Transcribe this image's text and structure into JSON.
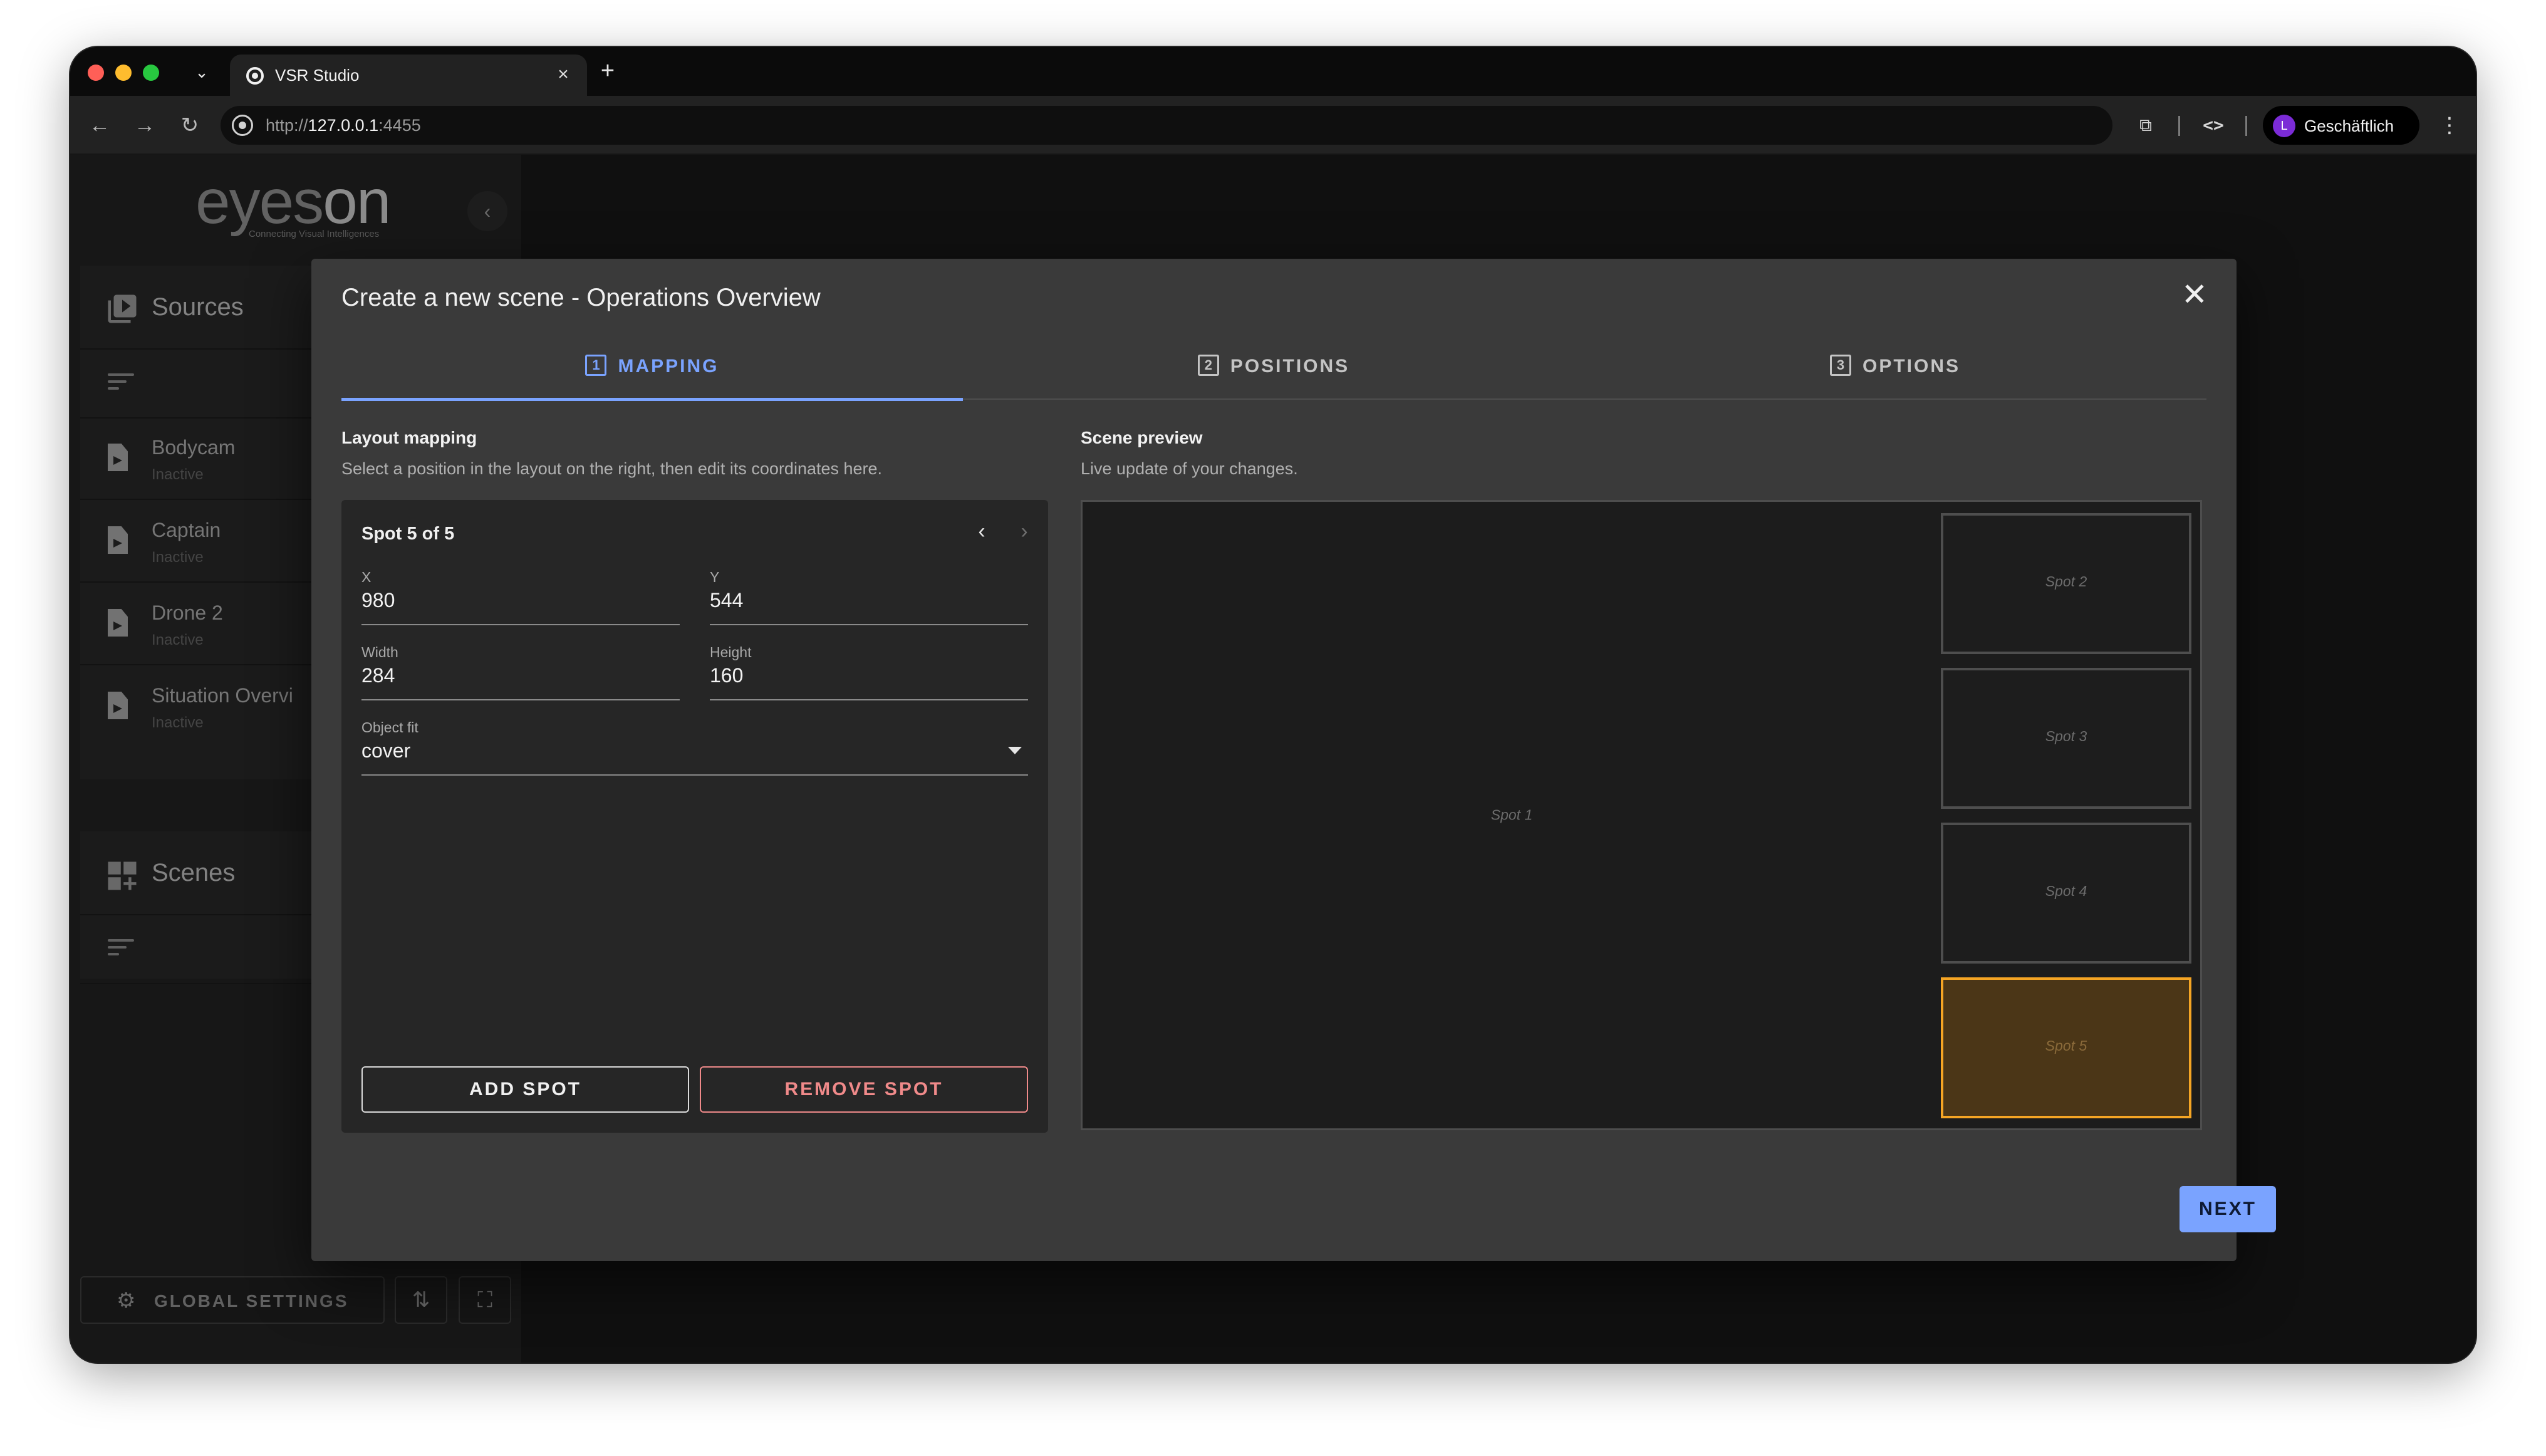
{
  "browser": {
    "tab_title": "VSR Studio",
    "tab_close": "×",
    "new_tab": "+",
    "tab_dropdown": "⌄",
    "url_scheme": "http://",
    "url_host": "127.0.0.1",
    "url_port": ":4455",
    "profile_initial": "L",
    "profile_name": "Geschäftlich",
    "icons": {
      "back": "←",
      "forward": "→",
      "reload": "↻",
      "extensions": "⧉",
      "code": "<>",
      "menu": "⋮"
    }
  },
  "sidebar": {
    "logo_text_a": "eyes",
    "logo_text_b": "on",
    "logo_tagline": "Connecting Visual Intelligences",
    "collapse": "‹",
    "sources_label": "Sources",
    "sources": [
      {
        "name": "Bodycam",
        "status": "Inactive"
      },
      {
        "name": "Captain",
        "status": "Inactive"
      },
      {
        "name": "Drone 2",
        "status": "Inactive"
      },
      {
        "name": "Situation Overvi",
        "status": "Inactive"
      }
    ],
    "scenes_label": "Scenes",
    "global_settings_label": "GLOBAL SETTINGS",
    "gear_glyph": "⚙",
    "sort_glyph": "⇅",
    "fullscreen_glyph": "⛶"
  },
  "dialog": {
    "title": "Create a new scene - Operations Overview",
    "close": "✕",
    "steps": [
      {
        "num": "1",
        "label": "MAPPING"
      },
      {
        "num": "2",
        "label": "POSITIONS"
      },
      {
        "num": "3",
        "label": "OPTIONS"
      }
    ],
    "mapping": {
      "title": "Layout mapping",
      "subtitle": "Select a position in the layout on the right, then edit its coordinates here.",
      "spot_counter": "Spot 5 of 5",
      "prev": "‹",
      "next": "›",
      "fields": {
        "x_label": "X",
        "x_value": "980",
        "y_label": "Y",
        "y_value": "544",
        "width_label": "Width",
        "width_value": "284",
        "height_label": "Height",
        "height_value": "160",
        "fit_label": "Object fit",
        "fit_value": "cover"
      },
      "add_spot": "ADD SPOT",
      "remove_spot": "REMOVE SPOT"
    },
    "preview": {
      "title": "Scene preview",
      "subtitle": "Live update of your changes.",
      "spots": [
        "Spot 1",
        "Spot 2",
        "Spot 3",
        "Spot 4",
        "Spot 5"
      ],
      "selected_spot": "Spot 5"
    },
    "next_label": "NEXT"
  },
  "colors": {
    "accent": "#7aa3ff",
    "danger": "#f08a8a",
    "selected_spot_border": "#f5a524",
    "selected_spot_fill": "#4b3617"
  }
}
